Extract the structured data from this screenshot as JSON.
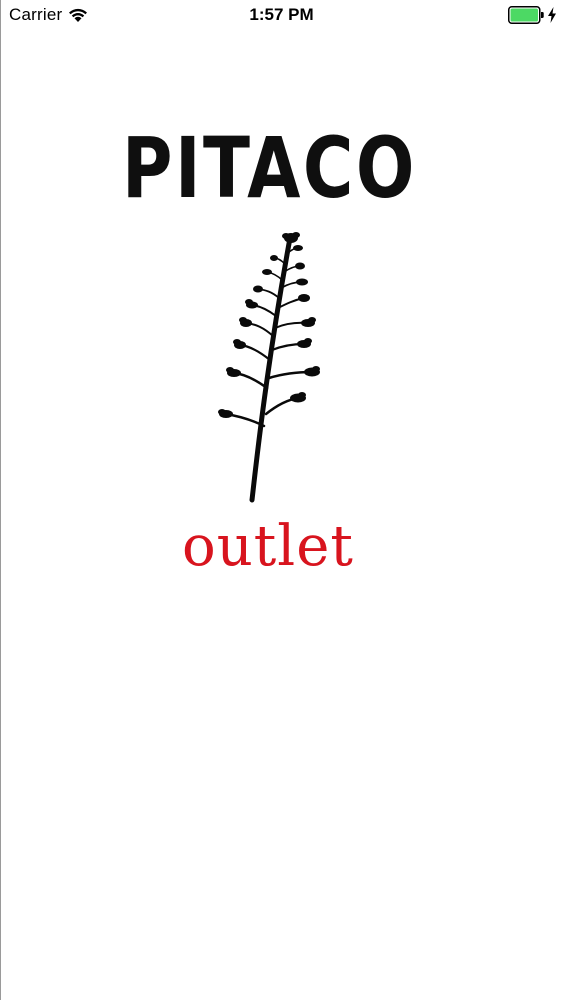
{
  "status_bar": {
    "carrier": "Carrier",
    "time": "1:57 PM",
    "wifi_icon": "wifi-icon",
    "battery_icon": "battery-icon",
    "charging_icon": "charging-bolt-icon",
    "battery_color": "#4cd964"
  },
  "splash": {
    "brand_name": "PITACO",
    "brand_color": "#0f0f0f",
    "logo_icon": "agave-tree-icon",
    "sub_label": "outlet",
    "sub_label_color": "#d8141e"
  }
}
